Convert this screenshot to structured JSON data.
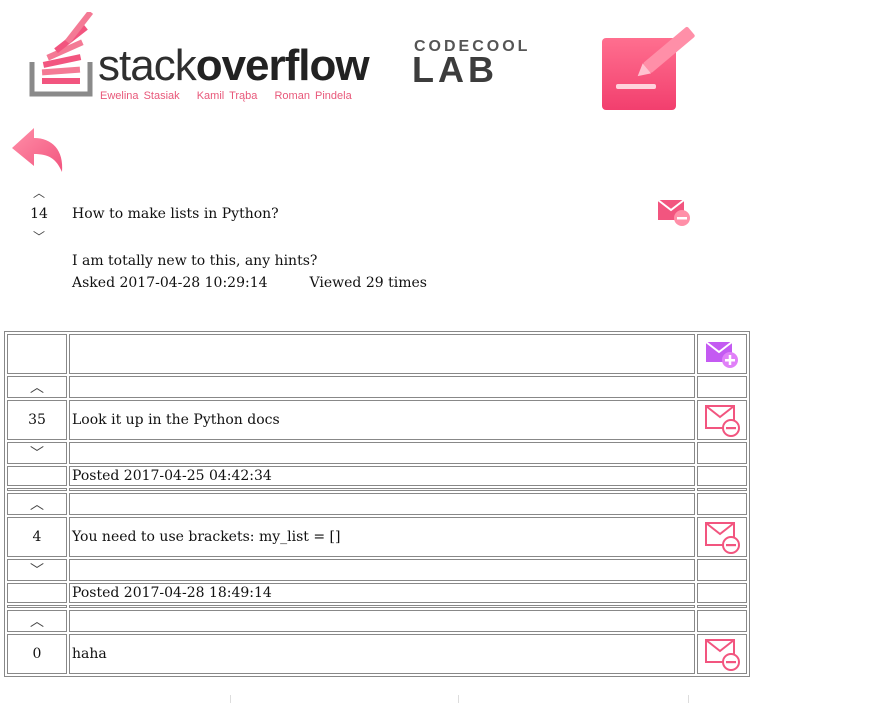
{
  "header": {
    "logo_so": {
      "word_light": "stack",
      "word_bold": "overflow"
    },
    "authors": [
      "Ewelina Stasiak",
      "Kamil Trąba",
      "Roman Pindela"
    ],
    "logo_cc": {
      "top": "CODECOOL",
      "bottom": "LAB"
    },
    "colors": {
      "accent": "#f2557f",
      "accent_light": "#ff8fa8",
      "purple": "#c45af2"
    }
  },
  "question": {
    "votes": "14",
    "title": "How to make lists in Python?",
    "body": "I am totally new to this, any hints?",
    "asked": "Asked 2017-04-28 10:29:14",
    "viewed": "Viewed 29 times",
    "up_glyph": "︿",
    "down_glyph": "﹀"
  },
  "answers": [
    {
      "votes": "35",
      "text": "Look it up in the Python docs",
      "posted": "Posted 2017-04-25 04:42:34"
    },
    {
      "votes": "4",
      "text": "You need to use brackets: my_list = []",
      "posted": "Posted 2017-04-28 18:49:14"
    },
    {
      "votes": "0",
      "text": "haha",
      "posted": ""
    }
  ],
  "icons": {
    "back": "back-arrow-icon",
    "edit": "edit-icon",
    "delete_mail": "mail-remove-icon",
    "add_mail": "mail-add-icon"
  }
}
